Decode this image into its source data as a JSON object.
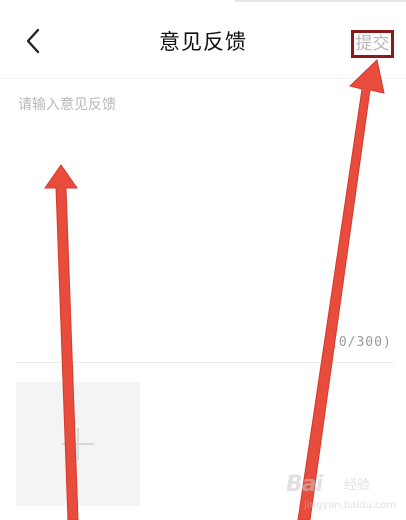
{
  "header": {
    "title": "意见反馈",
    "submit_label": "提交"
  },
  "feedback": {
    "placeholder": "请输入意见反馈",
    "value": "",
    "counter": "(0/300)"
  },
  "upload": {
    "icon": "plus-icon"
  },
  "annotations": {
    "arrow_color": "#e84c3d",
    "highlight_color": "#8b1a1a"
  },
  "watermark": {
    "brand": "Bai",
    "brand_cn": "经验",
    "url": "jingyan.baidu.com"
  }
}
